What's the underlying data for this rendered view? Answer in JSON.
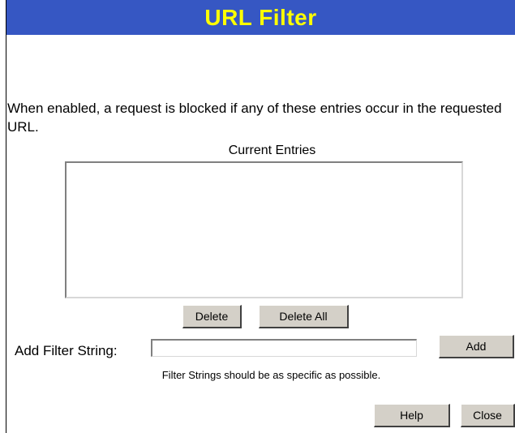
{
  "title": "URL Filter",
  "description": "When enabled, a request is blocked if any of these entries occur in the requested URL.",
  "entries": {
    "label": "Current Entries",
    "items": []
  },
  "buttons": {
    "delete": "Delete",
    "delete_all": "Delete All",
    "add": "Add",
    "help": "Help",
    "close": "Close"
  },
  "add_filter": {
    "label": "Add Filter String:",
    "value": "",
    "hint": "Filter Strings should be as specific as possible."
  },
  "colors": {
    "title_bar": "#3657c3",
    "title_text": "#ffff00",
    "button_face": "#d4d0c8"
  }
}
